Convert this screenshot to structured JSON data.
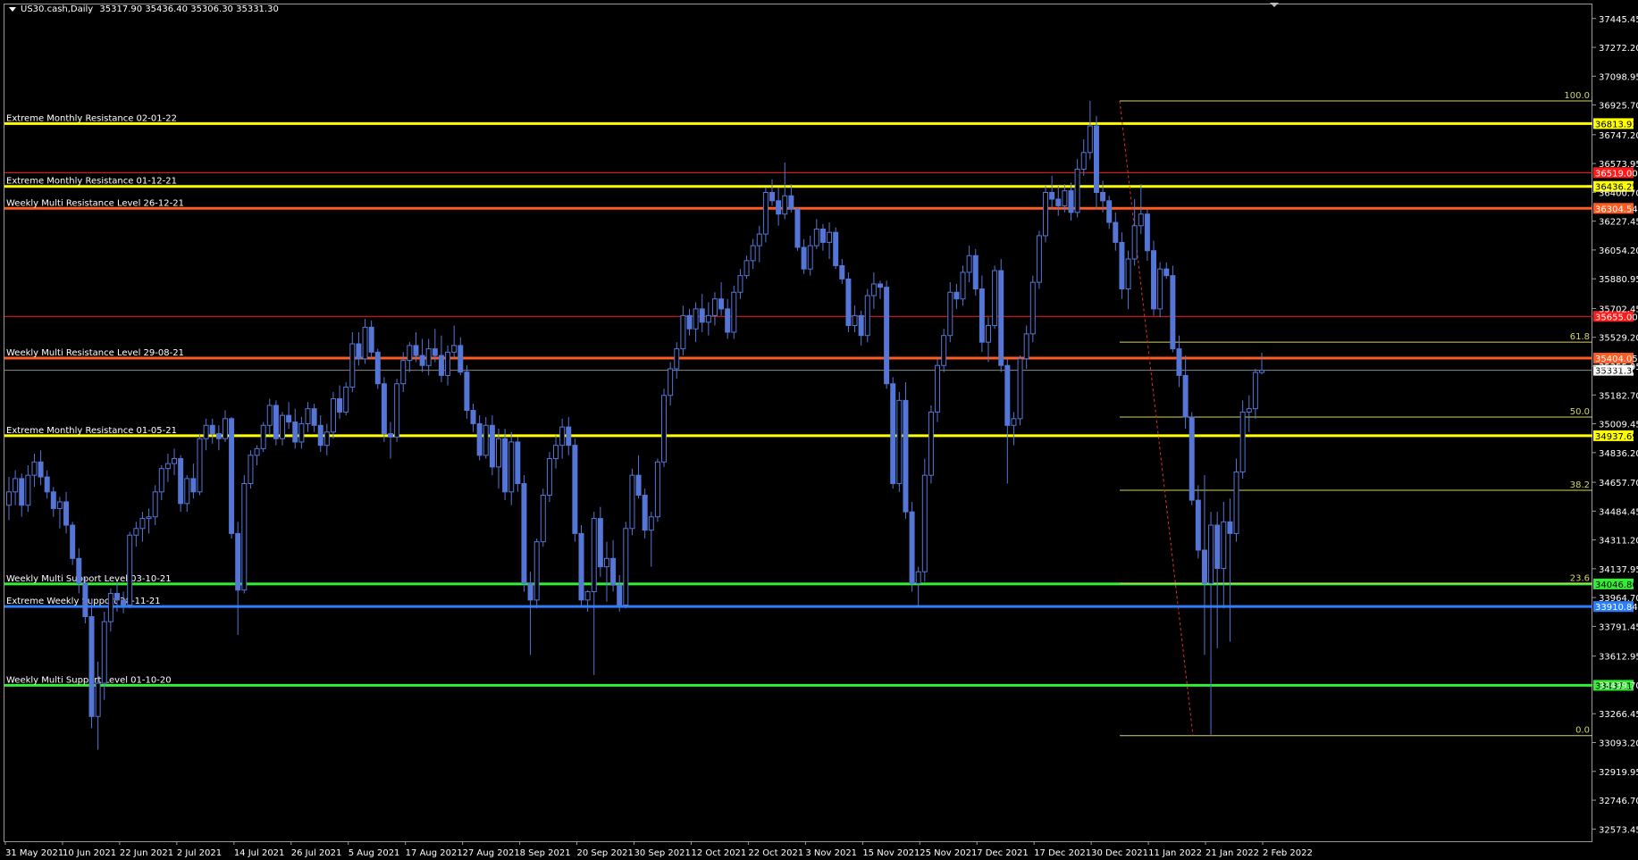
{
  "header": {
    "symbol": "US30.cash,Daily",
    "ohlc": "35317.90 35436.40 35306.30 35331.30"
  },
  "colors": {
    "background": "#000000",
    "candle": "#5576d6",
    "yellow_level": "#ffff00",
    "orange_level": "#ff5a1f",
    "red_level": "#ff1a1a",
    "green_level": "#33ee33",
    "blue_level": "#2a7fff",
    "fib": "#d4d46a"
  },
  "chart_data": {
    "type": "candlestick",
    "title": "US30.cash,Daily",
    "ylim": [
      32500,
      37530
    ],
    "y_ticks": [
      "37445.45",
      "37272.20",
      "37098.95",
      "36925.70",
      "36747.20",
      "36573.95",
      "36400.70",
      "36227.45",
      "36054.20",
      "35880.95",
      "35702.45",
      "35529.20",
      "35355.95",
      "35182.70",
      "35009.45",
      "34836.20",
      "34657.70",
      "34484.45",
      "34311.20",
      "34137.95",
      "33964.70",
      "33791.45",
      "33612.95",
      "33439.70",
      "33266.45",
      "33093.20",
      "32919.95",
      "32746.70",
      "32573.45"
    ],
    "x_ticks": [
      "31 May 2021",
      "10 Jun 2021",
      "22 Jun 2021",
      "2 Jul 2021",
      "14 Jul 2021",
      "26 Jul 2021",
      "5 Aug 2021",
      "17 Aug 2021",
      "27 Aug 2021",
      "8 Sep 2021",
      "20 Sep 2021",
      "30 Sep 2021",
      "12 Oct 2021",
      "22 Oct 2021",
      "3 Nov 2021",
      "15 Nov 2021",
      "25 Nov 2021",
      "7 Dec 2021",
      "17 Dec 2021",
      "30 Dec 2021",
      "11 Jan 2022",
      "21 Jan 2022",
      "2 Feb 2022"
    ],
    "current_price": "35331.30",
    "levels": [
      {
        "name": "Extreme Monthly Resistance 02-01-22",
        "value": 36813.93,
        "label": "36813.93",
        "color": "yellow",
        "width": 3
      },
      {
        "name": "",
        "value": 36519.0,
        "label": "36519.00",
        "color": "red",
        "width": 1
      },
      {
        "name": "Extreme Monthly Resistance 01-12-21",
        "value": 36436.25,
        "label": "36436.25",
        "color": "yellow",
        "width": 3
      },
      {
        "name": "Weekly Multi Resistance Level 26-12-21",
        "value": 36304.54,
        "label": "36304.54",
        "color": "orange",
        "width": 3
      },
      {
        "name": "",
        "value": 35655.0,
        "label": "35655.00",
        "color": "red",
        "width": 1
      },
      {
        "name": "Weekly Multi Resistance Level 29-08-21",
        "value": 35404.05,
        "label": "35404.05",
        "color": "orange",
        "width": 3
      },
      {
        "name": "Extreme Monthly Resistance 01-05-21",
        "value": 34937.69,
        "label": "34937.69",
        "color": "yellow",
        "width": 3
      },
      {
        "name": "Weekly Multi Support Level 03-10-21",
        "value": 34046.86,
        "label": "34046.86",
        "color": "green",
        "width": 3
      },
      {
        "name": "Extreme Weekly Support 28-11-21",
        "value": 33910.84,
        "label": "33910.84",
        "color": "blue",
        "width": 3
      },
      {
        "name": "Weekly Multi Support Level 01-10-20",
        "value": 33437.16,
        "label": "33437.16",
        "color": "green",
        "width": 3
      }
    ],
    "fib_levels": [
      {
        "label": "100.0",
        "value": 36950
      },
      {
        "label": "61.8",
        "value": 35500
      },
      {
        "label": "50.0",
        "value": 35050
      },
      {
        "label": "38.2",
        "value": 34610
      },
      {
        "label": "23.6",
        "value": 34050
      },
      {
        "label": "0.0",
        "value": 33135
      }
    ],
    "fib_trend": {
      "from": [
        36950,
        245
      ],
      "to": [
        33135,
        257
      ]
    },
    "candles": [
      [
        34520,
        34690,
        34430,
        34600
      ],
      [
        34600,
        34730,
        34520,
        34680
      ],
      [
        34680,
        34710,
        34450,
        34520
      ],
      [
        34520,
        34760,
        34480,
        34700
      ],
      [
        34700,
        34830,
        34630,
        34780
      ],
      [
        34780,
        34850,
        34640,
        34690
      ],
      [
        34690,
        34730,
        34560,
        34600
      ],
      [
        34600,
        34630,
        34450,
        34500
      ],
      [
        34500,
        34570,
        34380,
        34540
      ],
      [
        34540,
        34600,
        34350,
        34400
      ],
      [
        34400,
        34420,
        34160,
        34200
      ],
      [
        34200,
        34260,
        33990,
        34050
      ],
      [
        34050,
        34090,
        33810,
        33850
      ],
      [
        33850,
        33960,
        33180,
        33250
      ],
      [
        33250,
        33580,
        33050,
        33450
      ],
      [
        33450,
        33880,
        33350,
        33820
      ],
      [
        33820,
        34020,
        33760,
        33990
      ],
      [
        33990,
        34060,
        33880,
        33950
      ],
      [
        33950,
        34000,
        33870,
        33920
      ],
      [
        33920,
        34360,
        33900,
        34340
      ],
      [
        34340,
        34420,
        34270,
        34380
      ],
      [
        34380,
        34480,
        34300,
        34440
      ],
      [
        34440,
        34500,
        34350,
        34450
      ],
      [
        34450,
        34640,
        34400,
        34600
      ],
      [
        34600,
        34760,
        34550,
        34740
      ],
      [
        34740,
        34830,
        34660,
        34770
      ],
      [
        34770,
        34860,
        34700,
        34800
      ],
      [
        34800,
        34820,
        34480,
        34530
      ],
      [
        34530,
        34700,
        34480,
        34680
      ],
      [
        34680,
        34770,
        34560,
        34600
      ],
      [
        34600,
        34950,
        34580,
        34920
      ],
      [
        34920,
        35040,
        34850,
        35000
      ],
      [
        35000,
        35040,
        34890,
        34950
      ],
      [
        34950,
        35000,
        34850,
        34920
      ],
      [
        34920,
        35090,
        34900,
        35040
      ],
      [
        35040,
        35050,
        34320,
        34350
      ],
      [
        34350,
        34420,
        33740,
        34010
      ],
      [
        34010,
        34700,
        33990,
        34650
      ],
      [
        34650,
        34850,
        34620,
        34820
      ],
      [
        34820,
        34880,
        34760,
        34860
      ],
      [
        34860,
        35020,
        34840,
        35000
      ],
      [
        35000,
        35160,
        34940,
        35120
      ],
      [
        35120,
        35150,
        34880,
        34920
      ],
      [
        34920,
        35080,
        34880,
        35060
      ],
      [
        35060,
        35140,
        34980,
        35020
      ],
      [
        35020,
        35100,
        34860,
        34900
      ],
      [
        34900,
        35050,
        34860,
        35010
      ],
      [
        35010,
        35140,
        34960,
        35100
      ],
      [
        35100,
        35130,
        34960,
        35000
      ],
      [
        35000,
        35060,
        34840,
        34880
      ],
      [
        34880,
        35010,
        34820,
        34960
      ],
      [
        34960,
        35200,
        34920,
        35160
      ],
      [
        35160,
        35240,
        35040,
        35080
      ],
      [
        35080,
        35260,
        35060,
        35230
      ],
      [
        35230,
        35560,
        35200,
        35490
      ],
      [
        35490,
        35560,
        35360,
        35400
      ],
      [
        35400,
        35640,
        35370,
        35590
      ],
      [
        35590,
        35630,
        35400,
        35440
      ],
      [
        35440,
        35460,
        35220,
        35250
      ],
      [
        35250,
        35290,
        34900,
        34950
      ],
      [
        34950,
        35020,
        34800,
        34930
      ],
      [
        34930,
        35280,
        34900,
        35250
      ],
      [
        35250,
        35440,
        35200,
        35390
      ],
      [
        35390,
        35500,
        35320,
        35480
      ],
      [
        35480,
        35560,
        35380,
        35420
      ],
      [
        35420,
        35520,
        35320,
        35360
      ],
      [
        35360,
        35520,
        35300,
        35460
      ],
      [
        35460,
        35580,
        35380,
        35420
      ],
      [
        35420,
        35540,
        35260,
        35300
      ],
      [
        35300,
        35480,
        35240,
        35440
      ],
      [
        35440,
        35600,
        35400,
        35480
      ],
      [
        35480,
        35530,
        35300,
        35320
      ],
      [
        35320,
        35360,
        35040,
        35090
      ],
      [
        35090,
        35130,
        34960,
        35010
      ],
      [
        35010,
        35060,
        34790,
        34820
      ],
      [
        34820,
        35050,
        34800,
        35000
      ],
      [
        35000,
        35060,
        34700,
        34750
      ],
      [
        34750,
        34980,
        34620,
        34920
      ],
      [
        34920,
        34980,
        34550,
        34600
      ],
      [
        34600,
        34960,
        34520,
        34900
      ],
      [
        34900,
        34930,
        34600,
        34650
      ],
      [
        34650,
        34700,
        34000,
        34050
      ],
      [
        34050,
        34120,
        33620,
        33950
      ],
      [
        33950,
        34320,
        33900,
        34300
      ],
      [
        34300,
        34620,
        34270,
        34580
      ],
      [
        34580,
        34840,
        34540,
        34800
      ],
      [
        34800,
        34940,
        34740,
        34880
      ],
      [
        34880,
        35040,
        34800,
        34990
      ],
      [
        34990,
        35050,
        34820,
        34880
      ],
      [
        34880,
        34920,
        34300,
        34350
      ],
      [
        34350,
        34400,
        33910,
        33950
      ],
      [
        33950,
        34010,
        33880,
        34000
      ],
      [
        34000,
        34480,
        33500,
        34440
      ],
      [
        34440,
        34510,
        34090,
        34150
      ],
      [
        34150,
        34300,
        33940,
        34200
      ],
      [
        34200,
        34310,
        34000,
        34040
      ],
      [
        34040,
        34100,
        33880,
        33920
      ],
      [
        33920,
        34420,
        33900,
        34380
      ],
      [
        34380,
        34740,
        34340,
        34700
      ],
      [
        34700,
        34820,
        34560,
        34580
      ],
      [
        34580,
        34620,
        34320,
        34370
      ],
      [
        34370,
        34480,
        34150,
        34450
      ],
      [
        34450,
        34800,
        34420,
        34780
      ],
      [
        34780,
        35220,
        34750,
        35180
      ],
      [
        35180,
        35380,
        35120,
        35340
      ],
      [
        35340,
        35500,
        35280,
        35460
      ],
      [
        35460,
        35720,
        35420,
        35660
      ],
      [
        35660,
        35700,
        35540,
        35580
      ],
      [
        35580,
        35740,
        35500,
        35700
      ],
      [
        35700,
        35790,
        35560,
        35620
      ],
      [
        35620,
        35740,
        35540,
        35660
      ],
      [
        35660,
        35800,
        35600,
        35760
      ],
      [
        35760,
        35860,
        35660,
        35700
      ],
      [
        35700,
        35760,
        35520,
        35560
      ],
      [
        35560,
        35840,
        35520,
        35800
      ],
      [
        35800,
        35940,
        35760,
        35900
      ],
      [
        35900,
        36020,
        35880,
        35990
      ],
      [
        35990,
        36120,
        35940,
        36080
      ],
      [
        36080,
        36200,
        35980,
        36150
      ],
      [
        36150,
        36430,
        36100,
        36400
      ],
      [
        36400,
        36480,
        36320,
        36350
      ],
      [
        36350,
        36430,
        36200,
        36270
      ],
      [
        36270,
        36580,
        36240,
        36380
      ],
      [
        36380,
        36450,
        36280,
        36300
      ],
      [
        36300,
        36310,
        36050,
        36070
      ],
      [
        36070,
        36120,
        35910,
        35940
      ],
      [
        35940,
        36140,
        35900,
        36080
      ],
      [
        36080,
        36240,
        36060,
        36180
      ],
      [
        36180,
        36210,
        36050,
        36100
      ],
      [
        36100,
        36220,
        36000,
        36160
      ],
      [
        36160,
        36190,
        35940,
        35960
      ],
      [
        35960,
        36000,
        35850,
        35880
      ],
      [
        35880,
        35920,
        35560,
        35600
      ],
      [
        35600,
        35720,
        35560,
        35660
      ],
      [
        35660,
        35690,
        35480,
        35540
      ],
      [
        35540,
        35820,
        35500,
        35780
      ],
      [
        35780,
        35920,
        35700,
        35850
      ],
      [
        35850,
        35870,
        35760,
        35830
      ],
      [
        35830,
        35870,
        35220,
        35250
      ],
      [
        35250,
        35290,
        34620,
        34650
      ],
      [
        34650,
        35200,
        34600,
        35150
      ],
      [
        35150,
        35260,
        34440,
        34480
      ],
      [
        34480,
        34540,
        34000,
        34050
      ],
      [
        34050,
        34150,
        33910,
        34120
      ],
      [
        34120,
        34800,
        34060,
        34700
      ],
      [
        34700,
        35120,
        34650,
        35080
      ],
      [
        35080,
        35400,
        35020,
        35360
      ],
      [
        35360,
        35580,
        35320,
        35540
      ],
      [
        35540,
        35860,
        35500,
        35800
      ],
      [
        35800,
        35850,
        35700,
        35760
      ],
      [
        35760,
        35960,
        35720,
        35920
      ],
      [
        35920,
        36080,
        35860,
        36020
      ],
      [
        36020,
        36060,
        35780,
        35820
      ],
      [
        35820,
        35900,
        35440,
        35500
      ],
      [
        35500,
        35650,
        35380,
        35600
      ],
      [
        35600,
        35960,
        35580,
        35930
      ],
      [
        35930,
        36000,
        35320,
        35360
      ],
      [
        35360,
        35400,
        34650,
        35000
      ],
      [
        35000,
        35080,
        34880,
        35040
      ],
      [
        35040,
        35420,
        35000,
        35400
      ],
      [
        35400,
        35600,
        35340,
        35550
      ],
      [
        35550,
        35900,
        35500,
        35860
      ],
      [
        35860,
        36170,
        35820,
        36140
      ],
      [
        36140,
        36440,
        36100,
        36400
      ],
      [
        36400,
        36500,
        36300,
        36360
      ],
      [
        36360,
        36440,
        36260,
        36320
      ],
      [
        36320,
        36450,
        36280,
        36410
      ],
      [
        36410,
        36460,
        36230,
        36280
      ],
      [
        36280,
        36600,
        36250,
        36540
      ],
      [
        36540,
        36720,
        36500,
        36640
      ],
      [
        36640,
        36950,
        36600,
        36800
      ],
      [
        36800,
        36860,
        36300,
        36400
      ],
      [
        36400,
        36470,
        36280,
        36350
      ],
      [
        36350,
        36380,
        36180,
        36220
      ],
      [
        36220,
        36280,
        36050,
        36100
      ],
      [
        36100,
        36160,
        35760,
        35820
      ],
      [
        35820,
        36050,
        35700,
        36000
      ],
      [
        36000,
        36360,
        35960,
        36200
      ],
      [
        36200,
        36450,
        36150,
        36270
      ],
      [
        36270,
        36300,
        35990,
        36050
      ],
      [
        36050,
        36110,
        35660,
        35700
      ],
      [
        35700,
        35980,
        35650,
        35940
      ],
      [
        35940,
        35980,
        35880,
        35900
      ],
      [
        35900,
        35960,
        35440,
        35460
      ],
      [
        35460,
        35540,
        35230,
        35300
      ],
      [
        35300,
        35420,
        34980,
        35050
      ],
      [
        35050,
        35080,
        34520,
        34550
      ],
      [
        34550,
        34640,
        34200,
        34250
      ],
      [
        34250,
        34700,
        33620,
        34050
      ],
      [
        34050,
        34480,
        33140,
        34400
      ],
      [
        34400,
        34480,
        33660,
        34140
      ],
      [
        34140,
        34540,
        33900,
        34420
      ],
      [
        34420,
        34560,
        33700,
        34350
      ],
      [
        34350,
        34800,
        34300,
        34720
      ],
      [
        34720,
        35150,
        34680,
        35080
      ],
      [
        35080,
        35180,
        34960,
        35100
      ],
      [
        35100,
        35340,
        35040,
        35317.9
      ],
      [
        35317.9,
        35436.4,
        35306.3,
        35331.3
      ]
    ]
  }
}
